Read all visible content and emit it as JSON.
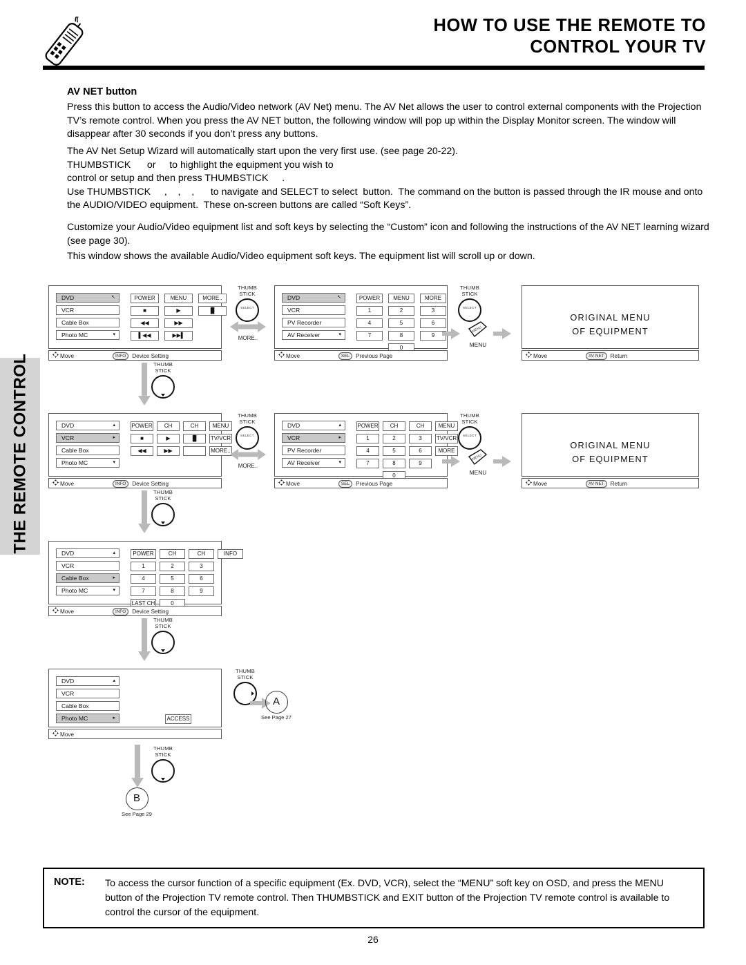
{
  "header": {
    "title_line1": "HOW TO USE THE REMOTE TO",
    "title_line2": "CONTROL YOUR TV",
    "logo_icon": "remote-control-icon"
  },
  "side_tab": {
    "label": "THE REMOTE CONTROL"
  },
  "body": {
    "sub_heading": "AV NET button",
    "paragraph_1": "Press this button to access the Audio/Video network (AV Net) menu.  The AV Net allows the user to control external components with the Projection TV’s remote control.  When you press the AV NET button, the following window will pop up within the Display Monitor screen.  The window will disappear after 30 seconds if you don’t press any buttons.",
    "paragraph_2": "The AV Net Setup Wizard will automatically start upon the very first use. (see page 20-22).\nTHUMBSTICK      or     to highlight the equipment you wish to\ncontrol or setup and then press THUMBSTICK     .\nUse THUMBSTICK     ,    ,    ,      to navigate and SELECT to select  button.  The command on the button is passed through the IR mouse and onto the AUDIO/VIDEO equipment.  These on-screen buttons are called “Soft Keys”.",
    "paragraph_3": "Customize your Audio/Video equipment list and soft keys by selecting the “Custom” icon and following the instructions of the AV NET learning wizard (see page 30).",
    "paragraph_4": "This window shows the available Audio/Video equipment soft keys.  The equipment list will scroll up or down."
  },
  "diagram": {
    "panels": [
      {
        "id": "panel-r1c1",
        "devices": [
          {
            "label": "DVD",
            "selected": true,
            "caret": "↖"
          },
          {
            "label": "VCR",
            "selected": false,
            "caret": ""
          },
          {
            "label": "Cable Box",
            "selected": false,
            "caret": ""
          },
          {
            "label": "Photo MC",
            "selected": false,
            "caret": "▾"
          }
        ],
        "keys": [
          {
            "label": "POWER",
            "row": 0,
            "col": 0
          },
          {
            "label": "MENU",
            "row": 0,
            "col": 1
          },
          {
            "label": "MORE..",
            "row": 0,
            "col": 2
          },
          {
            "label": "■",
            "row": 1,
            "col": 0
          },
          {
            "label": "▶",
            "row": 1,
            "col": 1
          },
          {
            "label": "▐▌",
            "row": 1,
            "col": 2
          },
          {
            "label": "◀◀",
            "row": 2,
            "col": 0
          },
          {
            "label": "▶▶",
            "row": 2,
            "col": 1
          },
          {
            "label": "▌◀◀",
            "row": 3,
            "col": 0
          },
          {
            "label": "▶▶▌",
            "row": 3,
            "col": 1
          }
        ],
        "status": {
          "move": "Move",
          "key": "INFO",
          "action": "Device Setting"
        }
      },
      {
        "id": "panel-r1c2",
        "devices": [
          {
            "label": "DVD",
            "selected": true,
            "caret": "↖"
          },
          {
            "label": "VCR",
            "selected": false,
            "caret": ""
          },
          {
            "label": "PV Recorder",
            "selected": false,
            "caret": ""
          },
          {
            "label": "AV Receiver",
            "selected": false,
            "caret": "▾"
          }
        ],
        "keys": [
          {
            "label": "POWER",
            "row": 0,
            "col": 0
          },
          {
            "label": "MENU",
            "row": 0,
            "col": 1
          },
          {
            "label": "MORE",
            "row": 0,
            "col": 2
          },
          {
            "label": "1",
            "row": 1,
            "col": 0
          },
          {
            "label": "2",
            "row": 1,
            "col": 1
          },
          {
            "label": "3",
            "row": 1,
            "col": 2
          },
          {
            "label": "4",
            "row": 2,
            "col": 0
          },
          {
            "label": "5",
            "row": 2,
            "col": 1
          },
          {
            "label": "6",
            "row": 2,
            "col": 2
          },
          {
            "label": "7",
            "row": 3,
            "col": 0
          },
          {
            "label": "8",
            "row": 3,
            "col": 1
          },
          {
            "label": "9",
            "row": 3,
            "col": 2
          },
          {
            "label": "0",
            "row": 4,
            "col": 1
          }
        ],
        "status": {
          "move": "Move",
          "key": "SEL",
          "action": "Previous Page"
        }
      },
      {
        "id": "panel-r1c3",
        "screen_text_line1": "ORIGINAL MENU",
        "screen_text_line2": "OF EQUIPMENT",
        "status": {
          "move": "Move",
          "key": "AV NET",
          "action": "Return"
        }
      },
      {
        "id": "panel-r2c1",
        "devices": [
          {
            "label": "DVD",
            "selected": false,
            "caret": "▴"
          },
          {
            "label": "VCR",
            "selected": true,
            "caret": "▸"
          },
          {
            "label": "Cable Box",
            "selected": false,
            "caret": ""
          },
          {
            "label": "Photo MC",
            "selected": false,
            "caret": "▾"
          }
        ],
        "keys": [
          {
            "label": "POWER",
            "row": 0,
            "col": 0
          },
          {
            "label": "CH",
            "row": 0,
            "col": 1
          },
          {
            "label": "CH",
            "row": 0,
            "col": 2
          },
          {
            "label": "MENU",
            "row": 0,
            "col": 3
          },
          {
            "label": "■",
            "row": 1,
            "col": 0
          },
          {
            "label": "▶",
            "row": 1,
            "col": 1
          },
          {
            "label": "▐▌",
            "row": 1,
            "col": 2
          },
          {
            "label": "TV/VCR",
            "row": 1,
            "col": 3
          },
          {
            "label": "◀◀",
            "row": 2,
            "col": 0
          },
          {
            "label": "▶▶",
            "row": 2,
            "col": 1
          },
          {
            "label": "",
            "row": 2,
            "col": 2
          },
          {
            "label": "MORE..",
            "row": 2,
            "col": 3
          }
        ],
        "status": {
          "move": "Move",
          "key": "INFO",
          "action": "Device Setting"
        }
      },
      {
        "id": "panel-r2c2",
        "devices": [
          {
            "label": "DVD",
            "selected": false,
            "caret": "▴"
          },
          {
            "label": "VCR",
            "selected": true,
            "caret": "▸"
          },
          {
            "label": "PV Recorder",
            "selected": false,
            "caret": ""
          },
          {
            "label": "AV Receiver",
            "selected": false,
            "caret": "▾"
          }
        ],
        "keys": [
          {
            "label": "POWER",
            "row": 0,
            "col": 0
          },
          {
            "label": "CH",
            "row": 0,
            "col": 1
          },
          {
            "label": "CH",
            "row": 0,
            "col": 2
          },
          {
            "label": "MENU",
            "row": 0,
            "col": 3
          },
          {
            "label": "1",
            "row": 1,
            "col": 0
          },
          {
            "label": "2",
            "row": 1,
            "col": 1
          },
          {
            "label": "3",
            "row": 1,
            "col": 2
          },
          {
            "label": "TV/VCR",
            "row": 1,
            "col": 3
          },
          {
            "label": "4",
            "row": 2,
            "col": 0
          },
          {
            "label": "5",
            "row": 2,
            "col": 1
          },
          {
            "label": "6",
            "row": 2,
            "col": 2
          },
          {
            "label": "MORE",
            "row": 2,
            "col": 3
          },
          {
            "label": "7",
            "row": 3,
            "col": 0
          },
          {
            "label": "8",
            "row": 3,
            "col": 1
          },
          {
            "label": "9",
            "row": 3,
            "col": 2
          },
          {
            "label": "0",
            "row": 4,
            "col": 1
          }
        ],
        "status": {
          "move": "Move",
          "key": "SEL",
          "action": "Previous Page"
        }
      },
      {
        "id": "panel-r2c3",
        "screen_text_line1": "ORIGINAL MENU",
        "screen_text_line2": "OF EQUIPMENT",
        "status": {
          "move": "Move",
          "key": "AV NET",
          "action": "Return"
        }
      },
      {
        "id": "panel-r3c1",
        "devices": [
          {
            "label": "DVD",
            "selected": false,
            "caret": "▴"
          },
          {
            "label": "VCR",
            "selected": false,
            "caret": ""
          },
          {
            "label": "Cable Box",
            "selected": true,
            "caret": "▸"
          },
          {
            "label": "Photo MC",
            "selected": false,
            "caret": "▾"
          }
        ],
        "keys": [
          {
            "label": "POWER",
            "row": 0,
            "col": 0
          },
          {
            "label": "CH",
            "row": 0,
            "col": 1
          },
          {
            "label": "CH",
            "row": 0,
            "col": 2
          },
          {
            "label": "INFO",
            "row": 0,
            "col": 3
          },
          {
            "label": "1",
            "row": 1,
            "col": 0
          },
          {
            "label": "2",
            "row": 1,
            "col": 1
          },
          {
            "label": "3",
            "row": 1,
            "col": 2
          },
          {
            "label": "4",
            "row": 2,
            "col": 0
          },
          {
            "label": "5",
            "row": 2,
            "col": 1
          },
          {
            "label": "6",
            "row": 2,
            "col": 2
          },
          {
            "label": "7",
            "row": 3,
            "col": 0
          },
          {
            "label": "8",
            "row": 3,
            "col": 1
          },
          {
            "label": "9",
            "row": 3,
            "col": 2
          },
          {
            "label": "LAST CH",
            "row": 4,
            "col": 0
          },
          {
            "label": "0",
            "row": 4,
            "col": 1
          }
        ],
        "status": {
          "move": "Move",
          "key": "INFO",
          "action": "Device Setting"
        }
      },
      {
        "id": "panel-r4c1",
        "devices": [
          {
            "label": "DVD",
            "selected": false,
            "caret": "▴"
          },
          {
            "label": "VCR",
            "selected": false,
            "caret": ""
          },
          {
            "label": "Cable Box",
            "selected": false,
            "caret": ""
          },
          {
            "label": "Photo MC",
            "selected": true,
            "caret": "▸"
          }
        ],
        "keys": [
          {
            "label": "ACCESS",
            "row": 3,
            "col": 0
          }
        ],
        "status": {
          "move": "Move",
          "key": "",
          "action": ""
        }
      }
    ],
    "connectors": {
      "thumbstick_label_line1": "THUMB",
      "thumbstick_label_line2": "STICK",
      "thumbstick_center": "SELECT",
      "more_label": "MORE..",
      "menu_label": "MENU",
      "menu_button_text": "MENU"
    },
    "page_refs": [
      {
        "letter": "A",
        "caption": "See Page 27"
      },
      {
        "letter": "B",
        "caption": "See Page 29"
      }
    ]
  },
  "note": {
    "label": "NOTE:",
    "text": "To access the cursor function of a specific equipment (Ex. DVD, VCR), select the “MENU” soft key on OSD, and press the MENU button of the Projection TV remote control.  Then THUMBSTICK and EXIT button of the Projection TV remote control is available to control the cursor of the equipment."
  },
  "page_number": "26"
}
